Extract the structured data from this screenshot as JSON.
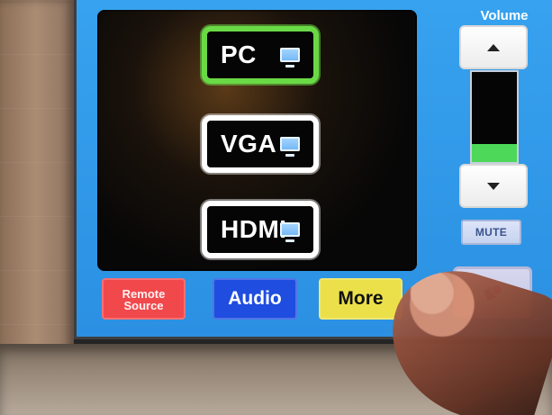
{
  "screen": {
    "volume_label": "Volume",
    "volume_level": 0.2,
    "colors": {
      "screen_blue": "#37a2ef",
      "pc_border": "#69da46",
      "remote_source": "#f1484c",
      "audio": "#1f4ddf",
      "more": "#ebe04a",
      "volume_fill": "#4dd85a"
    },
    "sources": [
      {
        "label": "PC",
        "icon": "monitor-icon"
      },
      {
        "label": "VGA",
        "icon": "monitor-icon"
      },
      {
        "label": "HDMI",
        "icon": "monitor-icon"
      }
    ],
    "bottom_buttons": {
      "remote_source_line1": "Remote",
      "remote_source_line2": "Source",
      "audio": "Audio",
      "more": "More"
    },
    "mute_label": "MUTE",
    "control_icon": "flag-icon"
  }
}
